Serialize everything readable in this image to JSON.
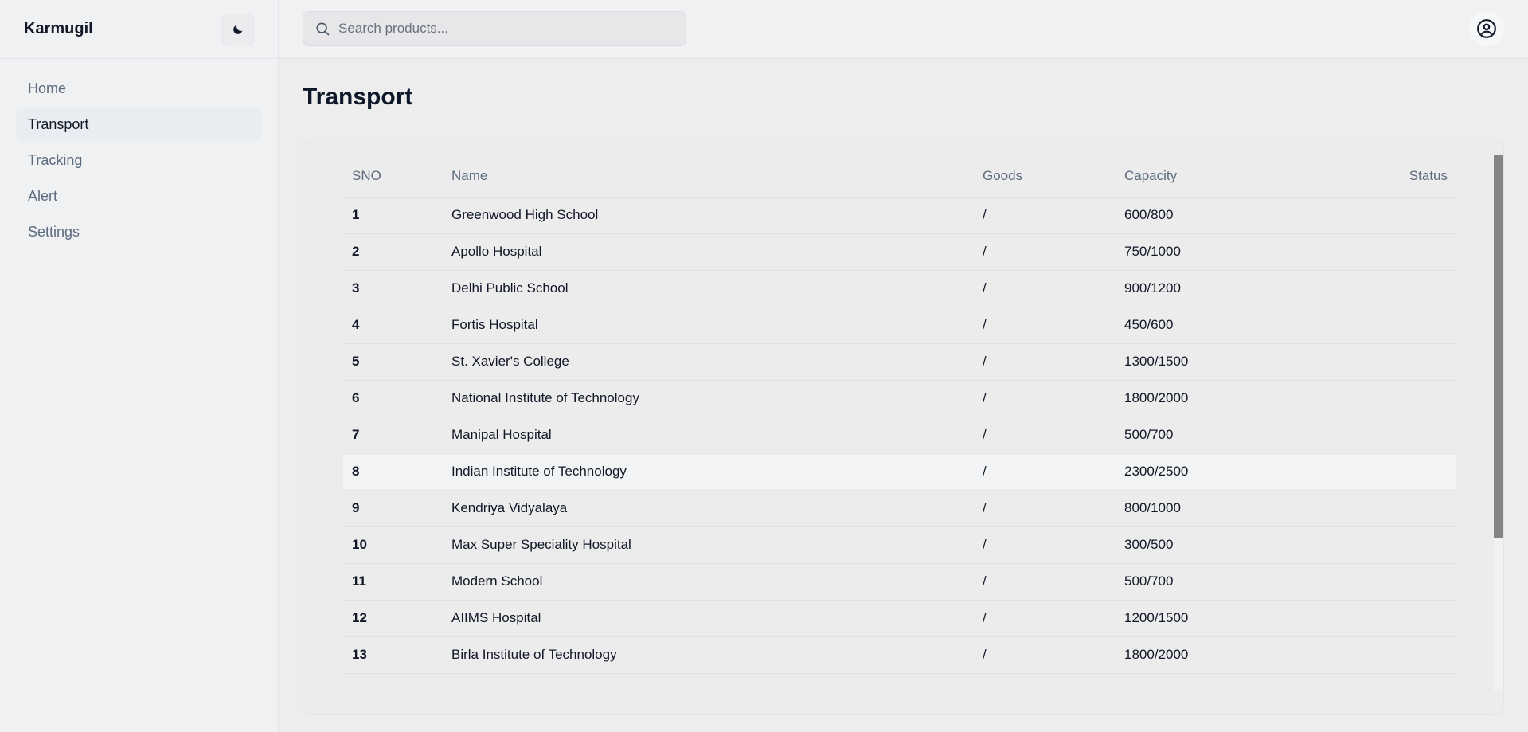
{
  "sidebar": {
    "brand": "Karmugil",
    "theme_toggle_icon": "moon-icon",
    "items": [
      {
        "label": "Home",
        "active": false
      },
      {
        "label": "Transport",
        "active": true
      },
      {
        "label": "Tracking",
        "active": false
      },
      {
        "label": "Alert",
        "active": false
      },
      {
        "label": "Settings",
        "active": false
      }
    ]
  },
  "header": {
    "search": {
      "placeholder": "Search products...",
      "value": "",
      "icon": "search-icon"
    },
    "profile_icon": "user-circle-icon"
  },
  "main": {
    "title": "Transport",
    "table": {
      "columns": [
        "SNO",
        "Name",
        "Goods",
        "Capacity",
        "Status"
      ],
      "rows": [
        {
          "sno": "1",
          "name": "Greenwood High School",
          "goods": "/",
          "capacity": "600/800",
          "status": ""
        },
        {
          "sno": "2",
          "name": "Apollo Hospital",
          "goods": "/",
          "capacity": "750/1000",
          "status": ""
        },
        {
          "sno": "3",
          "name": "Delhi Public School",
          "goods": "/",
          "capacity": "900/1200",
          "status": ""
        },
        {
          "sno": "4",
          "name": "Fortis Hospital",
          "goods": "/",
          "capacity": "450/600",
          "status": ""
        },
        {
          "sno": "5",
          "name": "St. Xavier's College",
          "goods": "/",
          "capacity": "1300/1500",
          "status": ""
        },
        {
          "sno": "6",
          "name": "National Institute of Technology",
          "goods": "/",
          "capacity": "1800/2000",
          "status": ""
        },
        {
          "sno": "7",
          "name": "Manipal Hospital",
          "goods": "/",
          "capacity": "500/700",
          "status": ""
        },
        {
          "sno": "8",
          "name": "Indian Institute of Technology",
          "goods": "/",
          "capacity": "2300/2500",
          "status": ""
        },
        {
          "sno": "9",
          "name": "Kendriya Vidyalaya",
          "goods": "/",
          "capacity": "800/1000",
          "status": ""
        },
        {
          "sno": "10",
          "name": "Max Super Speciality Hospital",
          "goods": "/",
          "capacity": "300/500",
          "status": ""
        },
        {
          "sno": "11",
          "name": "Modern School",
          "goods": "/",
          "capacity": "500/700",
          "status": ""
        },
        {
          "sno": "12",
          "name": "AIIMS Hospital",
          "goods": "/",
          "capacity": "1200/1500",
          "status": ""
        },
        {
          "sno": "13",
          "name": "Birla Institute of Technology",
          "goods": "/",
          "capacity": "1800/2000",
          "status": ""
        }
      ]
    }
  },
  "colors": {
    "background": "#ededed",
    "sidebar": "#f0f1f3",
    "active_item": "#e9ecf1",
    "muted_text": "#5d6b7e",
    "scrollbar_thumb": "#858585"
  }
}
